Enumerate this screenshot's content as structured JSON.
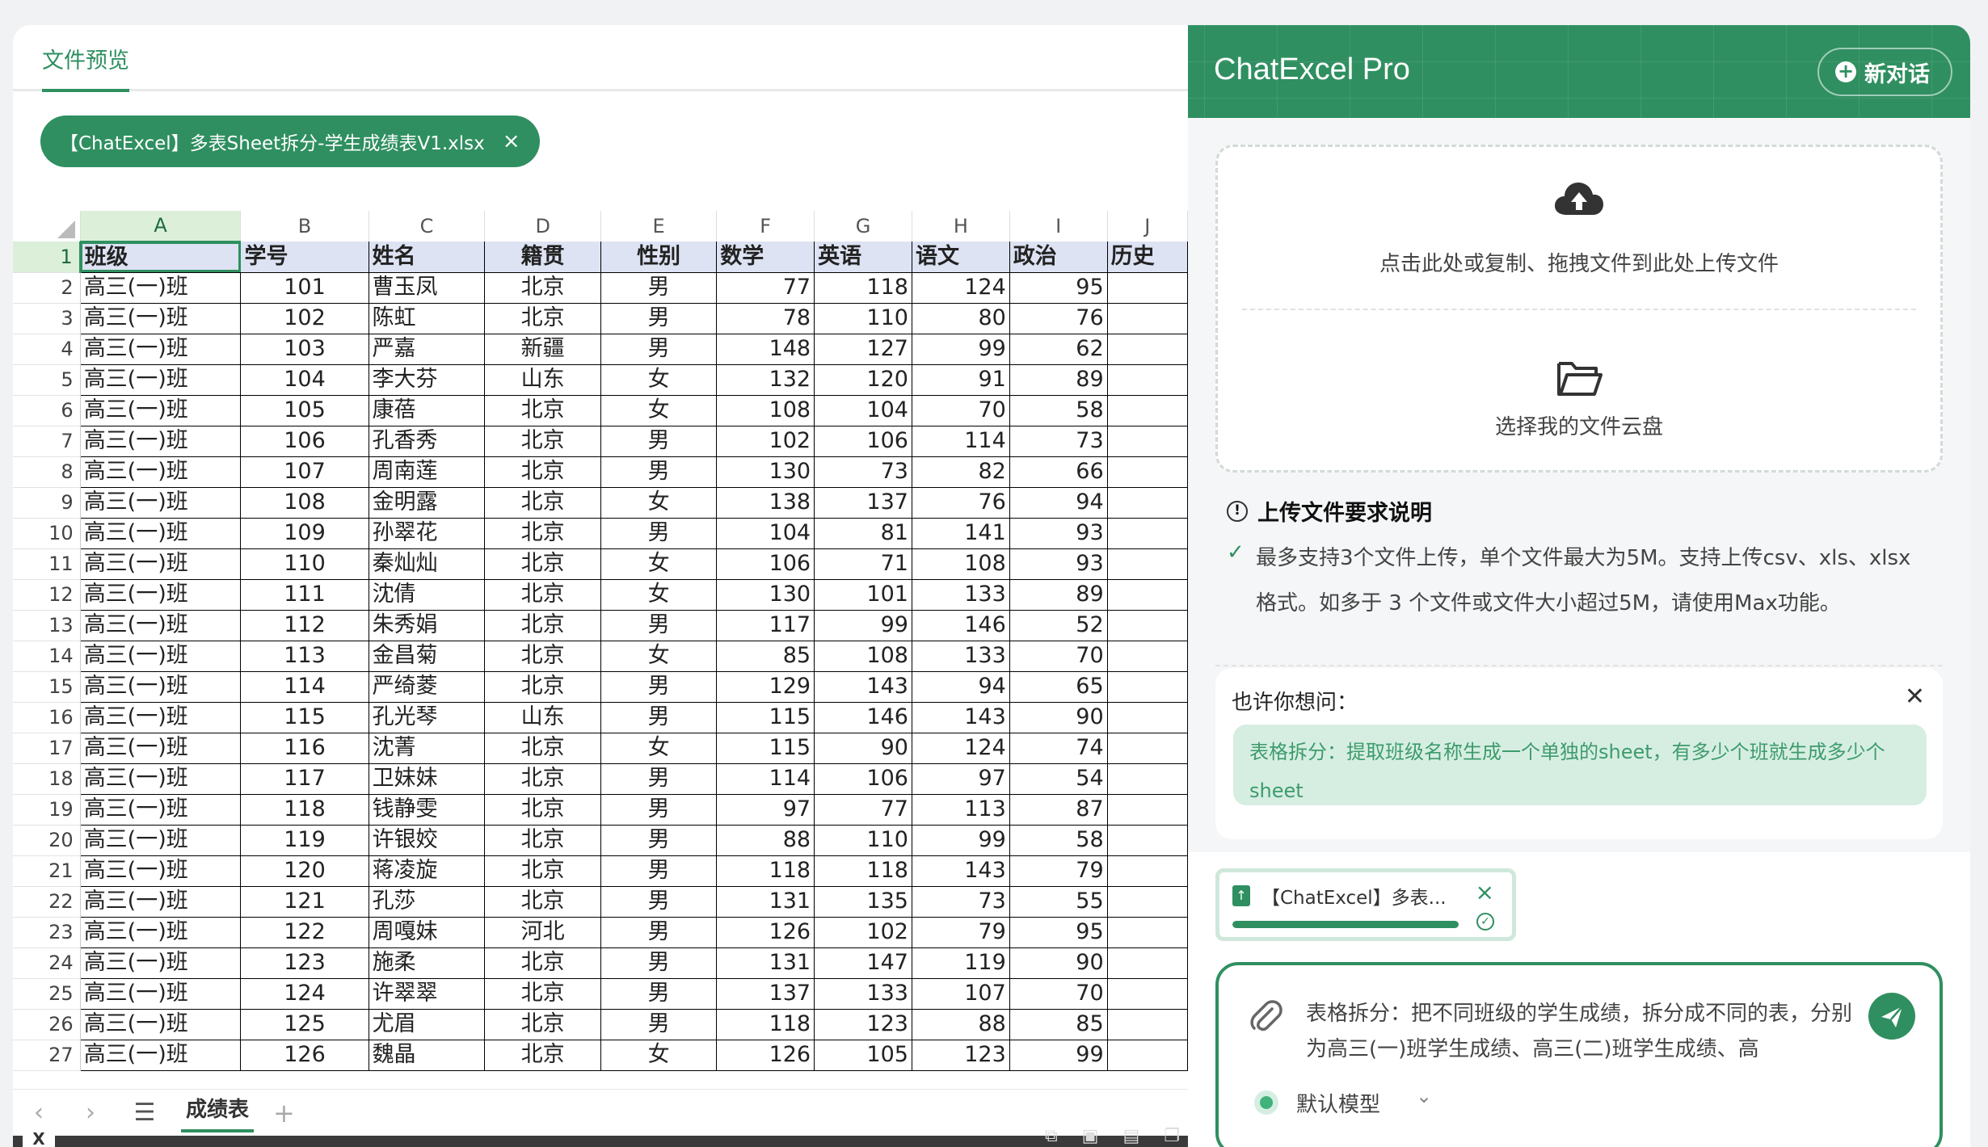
{
  "preview": {
    "tab_label": "文件预览",
    "file_chip": "【ChatExcel】多表Sheet拆分-学生成绩表V1.xlsx",
    "file_chip_close": "×"
  },
  "sheet": {
    "corner": "",
    "columns": [
      "A",
      "B",
      "C",
      "D",
      "E",
      "F",
      "G",
      "H",
      "I",
      "J"
    ],
    "header_row": [
      "班级",
      "学号",
      "姓名",
      "籍贯",
      "性别",
      "数学",
      "英语",
      "语文",
      "政治",
      "历史"
    ],
    "rows": [
      [
        "高三(一)班",
        "101",
        "曹玉凤",
        "北京",
        "男",
        "77",
        "118",
        "124",
        "95",
        ""
      ],
      [
        "高三(一)班",
        "102",
        "陈虹",
        "北京",
        "男",
        "78",
        "110",
        "80",
        "76",
        ""
      ],
      [
        "高三(一)班",
        "103",
        "严嘉",
        "新疆",
        "男",
        "148",
        "127",
        "99",
        "62",
        ""
      ],
      [
        "高三(一)班",
        "104",
        "李大芬",
        "山东",
        "女",
        "132",
        "120",
        "91",
        "89",
        ""
      ],
      [
        "高三(一)班",
        "105",
        "康蓓",
        "北京",
        "女",
        "108",
        "104",
        "70",
        "58",
        ""
      ],
      [
        "高三(一)班",
        "106",
        "孔香秀",
        "北京",
        "男",
        "102",
        "106",
        "114",
        "73",
        ""
      ],
      [
        "高三(一)班",
        "107",
        "周南莲",
        "北京",
        "男",
        "130",
        "73",
        "82",
        "66",
        ""
      ],
      [
        "高三(一)班",
        "108",
        "金明露",
        "北京",
        "女",
        "138",
        "137",
        "76",
        "94",
        ""
      ],
      [
        "高三(一)班",
        "109",
        "孙翠花",
        "北京",
        "男",
        "104",
        "81",
        "141",
        "93",
        ""
      ],
      [
        "高三(一)班",
        "110",
        "秦灿灿",
        "北京",
        "女",
        "106",
        "71",
        "108",
        "93",
        ""
      ],
      [
        "高三(一)班",
        "111",
        "沈倩",
        "北京",
        "女",
        "130",
        "101",
        "133",
        "89",
        ""
      ],
      [
        "高三(一)班",
        "112",
        "朱秀娟",
        "北京",
        "男",
        "117",
        "99",
        "146",
        "52",
        ""
      ],
      [
        "高三(一)班",
        "113",
        "金昌菊",
        "北京",
        "女",
        "85",
        "108",
        "133",
        "70",
        ""
      ],
      [
        "高三(一)班",
        "114",
        "严绮菱",
        "北京",
        "男",
        "129",
        "143",
        "94",
        "65",
        ""
      ],
      [
        "高三(一)班",
        "115",
        "孔光琴",
        "山东",
        "男",
        "115",
        "146",
        "143",
        "90",
        ""
      ],
      [
        "高三(一)班",
        "116",
        "沈菁",
        "北京",
        "女",
        "115",
        "90",
        "124",
        "74",
        ""
      ],
      [
        "高三(一)班",
        "117",
        "卫妹妹",
        "北京",
        "男",
        "114",
        "106",
        "97",
        "54",
        ""
      ],
      [
        "高三(一)班",
        "118",
        "钱静雯",
        "北京",
        "男",
        "97",
        "77",
        "113",
        "87",
        ""
      ],
      [
        "高三(一)班",
        "119",
        "许银姣",
        "北京",
        "男",
        "88",
        "110",
        "99",
        "58",
        ""
      ],
      [
        "高三(一)班",
        "120",
        "蒋凌旋",
        "北京",
        "男",
        "118",
        "118",
        "143",
        "79",
        ""
      ],
      [
        "高三(一)班",
        "121",
        "孔莎",
        "北京",
        "男",
        "131",
        "135",
        "73",
        "55",
        ""
      ],
      [
        "高三(一)班",
        "122",
        "周嘎妹",
        "河北",
        "男",
        "126",
        "102",
        "79",
        "95",
        ""
      ],
      [
        "高三(一)班",
        "123",
        "施柔",
        "北京",
        "男",
        "131",
        "147",
        "119",
        "90",
        ""
      ],
      [
        "高三(一)班",
        "124",
        "许翠翠",
        "北京",
        "男",
        "137",
        "133",
        "107",
        "70",
        ""
      ],
      [
        "高三(一)班",
        "125",
        "尤眉",
        "北京",
        "男",
        "118",
        "123",
        "88",
        "85",
        ""
      ],
      [
        "高三(一)班",
        "126",
        "魏晶",
        "北京",
        "女",
        "126",
        "105",
        "123",
        "99",
        ""
      ]
    ],
    "sheet_tab": "成绩表",
    "nav_prev": "‹",
    "nav_next": "›",
    "menu": "☰",
    "add": "+",
    "status_xl": "X"
  },
  "chat": {
    "title": "ChatExcel Pro",
    "new_chat": "新对话",
    "upload_text": "点击此处或复制、拖拽文件到此处上传文件",
    "cloud_text": "选择我的文件云盘",
    "req_title": "上传文件要求说明",
    "req_text": "最多支持3个文件上传，单个文件最大为5M。支持上传csv、xls、xlsx格式。如多于 3 个文件或文件大小超过5M，请使用Max功能。",
    "suggest_label": "也许你想问：",
    "suggest_text": "表格拆分：提取班级名称生成一个单独的sheet，有多少个班就生成多少个sheet",
    "attachment_name": "【ChatExcel】多表...",
    "attachment_progress": 1.0,
    "input_text": "表格拆分：把不同班级的学生成绩，拆分成不同的表，分别为高三(一)班学生成绩、高三(二)班学生成绩、高",
    "model_label": "默认模型",
    "accent_color": "#2f8f60"
  }
}
